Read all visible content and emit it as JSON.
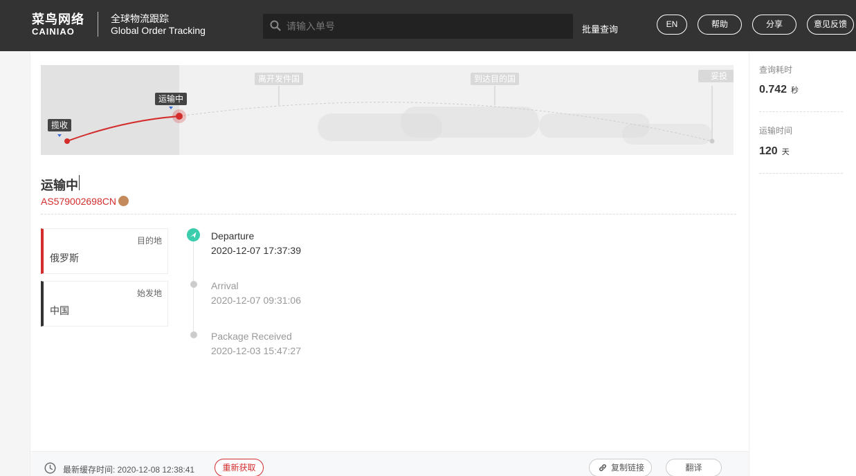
{
  "header": {
    "logo_cn": "菜鸟网络",
    "logo_en": "CAINIAO",
    "title_cn": "全球物流跟踪",
    "title_en": "Global Order Tracking",
    "search_placeholder": "请输入单号",
    "batch_query": "批量查询",
    "buttons": {
      "lang": "EN",
      "help": "帮助",
      "share": "分享",
      "feedback": "意见反馈"
    }
  },
  "map": {
    "stages": [
      "揽收",
      "运输中",
      "离开发件国",
      "到达目的国",
      "妥投"
    ],
    "current_stage": "运输中",
    "colors": {
      "progress": "#d32d2d"
    }
  },
  "status": {
    "title": "运输中",
    "tracking_number": "AS579002698CN"
  },
  "locations": {
    "destination_label": "目的地",
    "destination_value": "俄罗斯",
    "origin_label": "始发地",
    "origin_value": "中国"
  },
  "events": [
    {
      "title": "Departure",
      "time": "2020-12-07 17:37:39"
    },
    {
      "title": "Arrival",
      "time": "2020-12-07 09:31:06"
    },
    {
      "title": "Package Received",
      "time": "2020-12-03 15:47:27"
    }
  ],
  "footer": {
    "cache_text": "最新缓存时间: 2020-12-08 12:38:41",
    "refresh": "重新获取",
    "copy_link": "复制链接",
    "translate": "翻译"
  },
  "stats": {
    "query_time_label": "查询耗时",
    "query_time_value": "0.742",
    "query_time_unit": "秒",
    "transit_time_label": "运输时间",
    "transit_time_value": "120",
    "transit_time_unit": "天"
  }
}
